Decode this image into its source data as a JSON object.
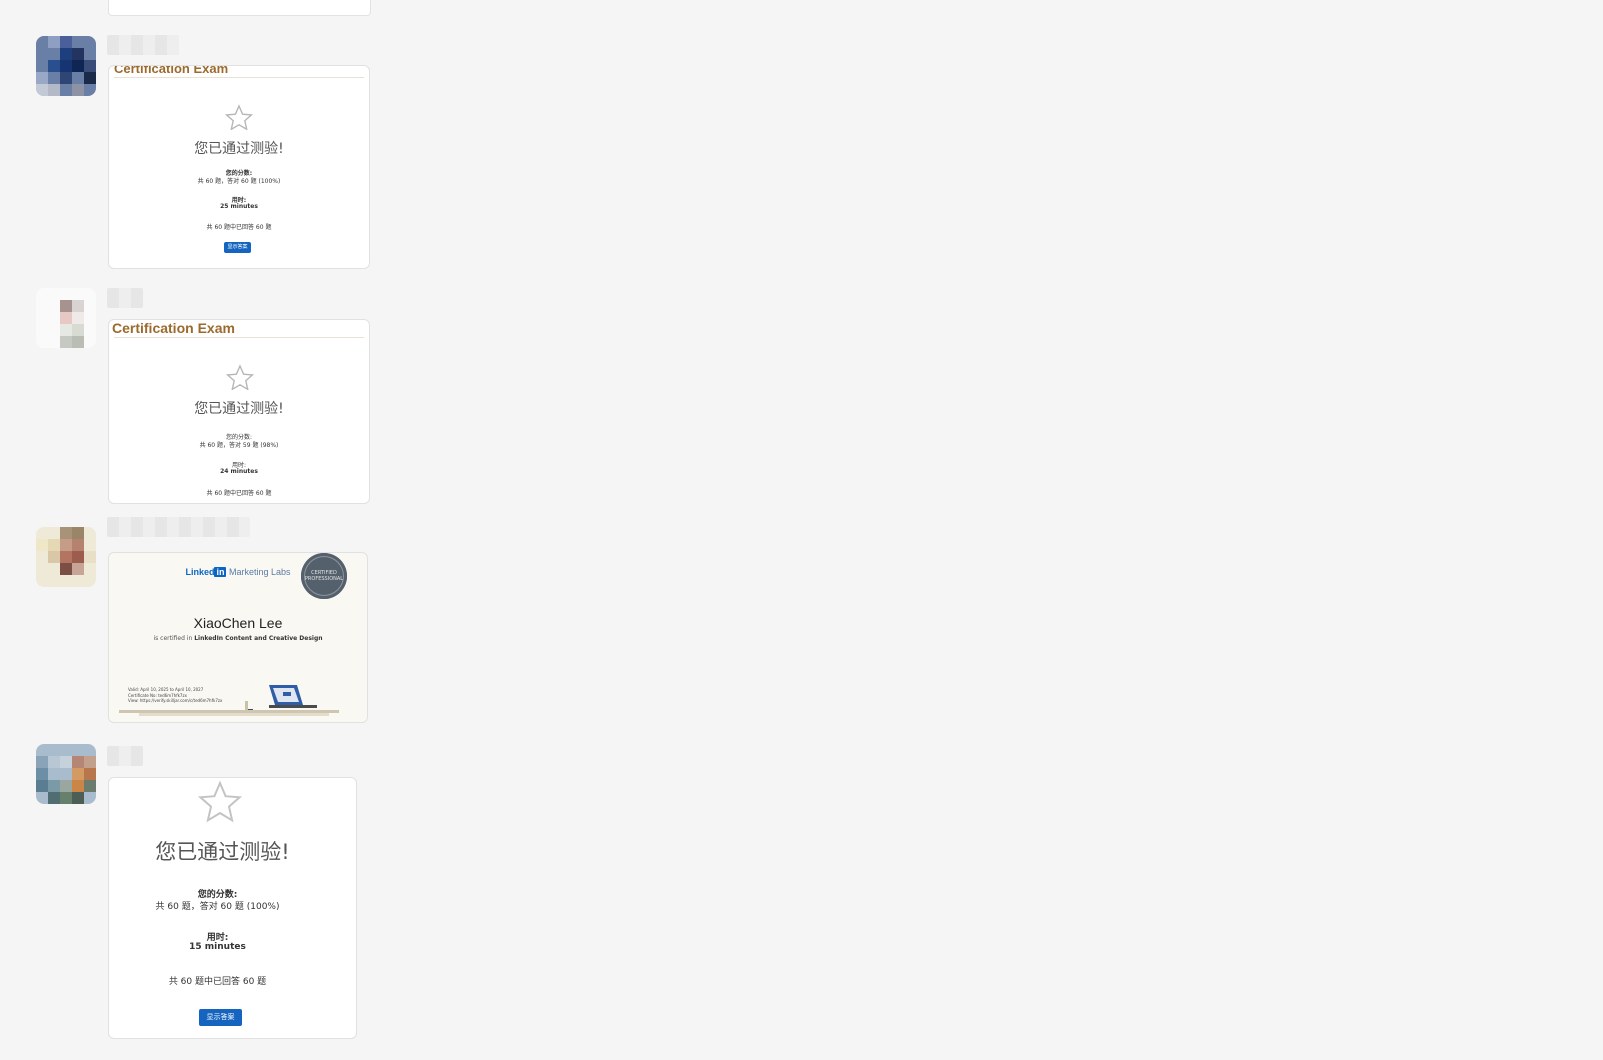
{
  "messages": [
    {
      "card": {
        "type": "exam",
        "header": "Certification Exam",
        "title": "您已通过测验!",
        "score_label": "您的分数:",
        "score_text": "共 60 题，答对 60 题 (100%)",
        "time_label": "用时:",
        "time_value": "25 minutes",
        "answered_text": "共 60 题中已回答 60 题",
        "button_label": "显示答案"
      }
    },
    {
      "card": {
        "type": "exam",
        "header": "Certification Exam",
        "title": "您已通过测验!",
        "score_label": "您的分数:",
        "score_text": "共 60 题，答对 59 题 (98%)",
        "time_label": "用时:",
        "time_value": "24 minutes",
        "answered_text": "共 60 题中已回答 60 题"
      }
    },
    {
      "card": {
        "type": "certificate",
        "logo_word": "Linked",
        "logo_box": "in",
        "logo_rest": "Marketing Labs",
        "seal_text": "CERTIFIED PROFESSIONAL",
        "name": "XiaoChen Lee",
        "subtitle_prefix": "is certified in",
        "subtitle_course": "LinkedIn Content and Creative Design",
        "valid_line": "Valid: April 10, 2025 to April 10, 2027",
        "cert_no_line": "Certificate No: ted6m7hfk7zx",
        "view_line": "View: https://verify.skilljar.com/c/ted6m7hfk7zx"
      }
    },
    {
      "card": {
        "type": "exam-large",
        "title": "您已通过测验!",
        "score_label": "您的分数:",
        "score_text": "共 60 题，答对 60 题 (100%)",
        "time_label": "用时:",
        "time_value": "15 minutes",
        "answered_text": "共 60 题中已回答 60 题",
        "button_label": "显示答案"
      }
    }
  ]
}
